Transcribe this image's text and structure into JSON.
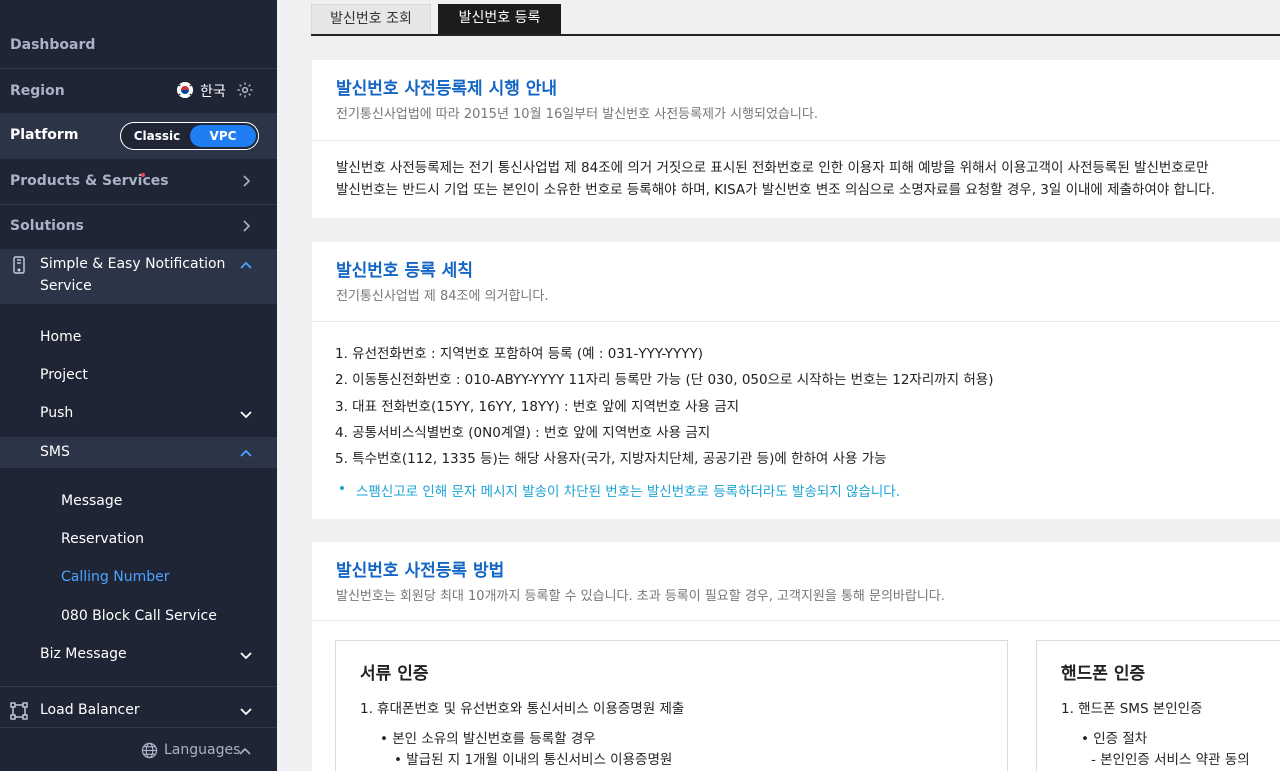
{
  "sidebar": {
    "dashboard": "Dashboard",
    "region_label": "Region",
    "region_value": "한국",
    "platform_label": "Platform",
    "platform_options": {
      "classic": "Classic",
      "vpc": "VPC"
    },
    "products_label": "Products & Services",
    "solutions_label": "Solutions",
    "service_name": "Simple & Easy Notification Service",
    "service_name_line1": "Simple & Easy Notification",
    "service_name_line2": "Service",
    "menu": {
      "home": "Home",
      "project": "Project",
      "push": "Push",
      "sms": "SMS",
      "sms_children": {
        "message": "Message",
        "reservation": "Reservation",
        "calling_number": "Calling Number",
        "block_call": "080 Block Call Service"
      },
      "biz_message": "Biz Message"
    },
    "load_balancer": "Load Balancer",
    "languages": "Languages",
    "colors": {
      "bg": "#1f2535",
      "active_link": "#4da3ff",
      "vpc_toggle": "#1f7ef2",
      "notify_dot": "#e84a4a"
    }
  },
  "tabs": [
    {
      "label": "발신번호 조회",
      "active": false
    },
    {
      "label": "발신번호 등록",
      "active": true
    }
  ],
  "section1": {
    "title": "발신번호 사전등록제 시행 안내",
    "subtitle": "전기통신사업법에 따라 2015년 10월 16일부터 발신번호 사전등록제가 시행되었습니다.",
    "body_line1": "발신번호 사전등록제는 전기 통신사업법 제 84조에 의거 거짓으로 표시된 전화번호로 인한 이용자 피해 예방을 위해서 이용고객이 사전등록된 발신번호로만",
    "body_line2": "발신번호는 반드시 기업 또는 본인이 소유한 번호로 등록해야 하며, KISA가 발신번호 변조 의심으로 소명자료를 요청할 경우, 3일 이내에 제출하여야 합니다."
  },
  "section2": {
    "title": "발신번호 등록 세칙",
    "subtitle": "전기통신사업법 제 84조에 의거합니다.",
    "rules": [
      "1. 유선전화번호 : 지역번호 포함하여 등록 (예 : 031-YYY-YYYY)",
      "2. 이동통신전화번호 : 010-ABYY-YYYY 11자리 등록만 가능 (단 030, 050으로 시작하는 번호는 12자리까지 허용)",
      "3. 대표 전화번호(15YY, 16YY, 18YY) : 번호 앞에 지역번호 사용 금지",
      "4. 공통서비스식별번호 (0N0계열) : 번호 앞에 지역번호 사용 금지",
      "5. 특수번호(112, 1335 등)는 해당 사용자(국가, 지방자치단체, 공공기관 등)에 한하여 사용 가능"
    ],
    "note": "스팸신고로 인해 문자 메시지 발송이 차단된 번호는 발신번호로 등록하더라도 발송되지 않습니다."
  },
  "section3": {
    "title": "발신번호 사전등록 방법",
    "subtitle": "발신번호는 회원당 최대 10개까지 등록할 수 있습니다. 초과 등록이 필요할 경우, 고객지원을 통해 문의바랍니다.",
    "document_auth": {
      "title": "서류 인증",
      "item1": "1. 휴대폰번호 및 유선번호와 통신서비스 이용증명원 제출",
      "bullet1": "• 본인 소유의 발신번호를 등록할 경우",
      "sub1": "• 발급된 지 1개월 이내의 통신서비스 이용증명원"
    },
    "phone_auth": {
      "title": "핸드폰 인증",
      "item1": "1. 핸드폰 SMS 본인인증",
      "bullet1": "• 인증 절차",
      "sub1": "- 본인인증 서비스 약관 동의"
    }
  }
}
